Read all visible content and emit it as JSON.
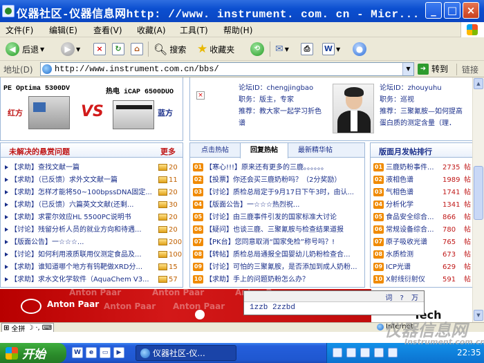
{
  "window": {
    "title": "仪器社区-仪器信息网http: //www. instrument. com. cn - Micr...",
    "buttons": {
      "minimize": "_",
      "maximize": "□",
      "close": "×"
    }
  },
  "menu": [
    "文件(F)",
    "编辑(E)",
    "查看(V)",
    "收藏(A)",
    "工具(T)",
    "帮助(H)"
  ],
  "toolbar": {
    "back": "后退",
    "search": "搜索",
    "favorites": "收藏夹"
  },
  "address": {
    "label": "地址(D)",
    "url": "http://www.instrument.com.cn/bbs/",
    "go": "转到",
    "links": "链接"
  },
  "pk": {
    "left_title": "PE Optima 5300DV",
    "right_title": "热电 iCAP 6500DUO",
    "vs": "VS",
    "red": "红方",
    "blue": "蓝方"
  },
  "profiles": [
    {
      "id": "论坛ID：chengjingbao",
      "role": "职务：版主，专家",
      "rec1": "推荐：教大家一起学习折色",
      "rec2": "谱"
    },
    {
      "id": "论坛ID：zhouyuhu",
      "role": "职务：巡视",
      "rec1": "推荐：三聚氰胺—如何提高",
      "rec2": "蛋白质的测定含量（理．"
    }
  ],
  "unsolved": {
    "title": "未解决的悬赏问题",
    "more": "更多",
    "items": [
      {
        "text": "【求助】查找文献一篇",
        "reward": "20"
      },
      {
        "text": "【求助】（已反馈）求外文文献一篇",
        "reward": "11"
      },
      {
        "text": "【求助】怎样才能将50~100bpssDNA固定...",
        "reward": "20"
      },
      {
        "text": "【求助】（已反馈）六篇英文文献(还剩...",
        "reward": "30"
      },
      {
        "text": "【求助】求霍尔效应HL 5500PC说明书",
        "reward": "20"
      },
      {
        "text": "【讨论】残留分析人员的就业方向和待遇...",
        "reward": "20"
      },
      {
        "text": "【版面公告】一☆☆☆...",
        "reward": "200"
      },
      {
        "text": "【讨论】如何利用液质联用仪测定食品及...",
        "reward": "100"
      },
      {
        "text": "【求助】谁知道哪个地方有钨靶做XRD分...",
        "reward": "15"
      },
      {
        "text": "【求助】求水文化学软件（AquaChem V3...",
        "reward": "57"
      }
    ]
  },
  "middle": {
    "tabs": [
      "点击热帖",
      "回复热帖",
      "最新精华帖"
    ],
    "items": [
      {
        "n": "01",
        "text": "【寒心!!!】原来还有更多的三鹿。。。。。。"
      },
      {
        "n": "02",
        "text": "【投票】你还会买三鹿奶粉吗？（2分奖励）"
      },
      {
        "n": "03",
        "text": "【讨论】质检总局定于9月17日下午3时，由认..."
      },
      {
        "n": "04",
        "text": "【版面公告】一☆☆☆热烈祝..."
      },
      {
        "n": "05",
        "text": "【讨论】由三鹿事件引发的国家标准大讨论"
      },
      {
        "n": "06",
        "text": "【疑问】也谈三鹿、三聚氰胺与检查结果道报"
      },
      {
        "n": "07",
        "text": "【PK台】您同意取消“国家免检”称号吗？!"
      },
      {
        "n": "08",
        "text": "【转帖】质检总局通报全国婴幼儿奶粉检查合..."
      },
      {
        "n": "09",
        "text": "【讨论】可怕的三聚氰胺，是否添加到成人奶粉..."
      },
      {
        "n": "10",
        "text": "【求助】手上的问题奶粉怎么办？"
      }
    ]
  },
  "right": {
    "title": "版面月发帖排行",
    "items": [
      {
        "n": "01",
        "name": "三鹿奶粉事件...",
        "count": "2735",
        "unit": "帖"
      },
      {
        "n": "02",
        "name": "液相色谱",
        "count": "1989",
        "unit": "帖"
      },
      {
        "n": "03",
        "name": "气相色谱",
        "count": "1741",
        "unit": "帖"
      },
      {
        "n": "04",
        "name": "分析化学",
        "count": "1341",
        "unit": "帖"
      },
      {
        "n": "05",
        "name": "食品安全综合...",
        "count": "866",
        "unit": "帖"
      },
      {
        "n": "06",
        "name": "常规设备综合...",
        "count": "780",
        "unit": "帖"
      },
      {
        "n": "07",
        "name": "原子吸收光谱",
        "count": "765",
        "unit": "帖"
      },
      {
        "n": "08",
        "name": "水质检测",
        "count": "673",
        "unit": "帖"
      },
      {
        "n": "09",
        "name": "ICP光谱",
        "count": "629",
        "unit": "帖"
      },
      {
        "n": "10",
        "name": "X射线衍射仪",
        "count": "591",
        "unit": "帖"
      }
    ]
  },
  "banner": {
    "brand": "Anton Paar",
    "ghost": "Anton Paar",
    "tech": "Tech"
  },
  "ime_popup": {
    "buttons": "词 ? 万",
    "candidates": "1zzb 2zzbd"
  },
  "status": {
    "ime": "全拼",
    "zone": "Internet"
  },
  "taskbar": {
    "start": "开始",
    "task": "仪器社区-仪...",
    "time": "22:35"
  },
  "watermark": {
    "text": "仪器信息网",
    "sub": "Instrument.com.cn"
  }
}
